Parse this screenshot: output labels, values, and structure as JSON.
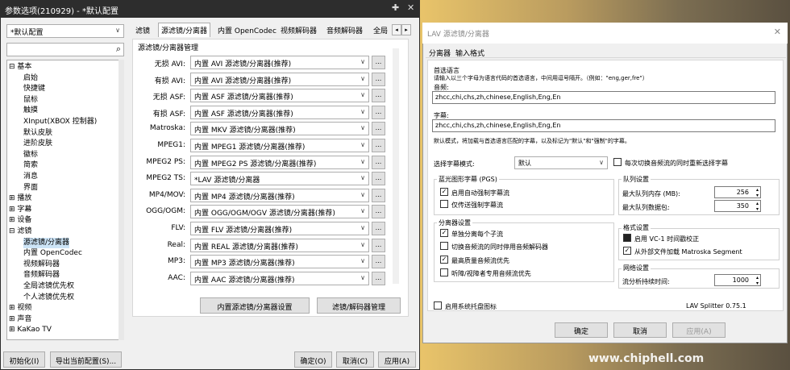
{
  "left": {
    "title": "参数选项(210929) - *默认配置",
    "profile": "*默认配置",
    "tree": [
      {
        "t": "基本",
        "lvl": 0,
        "exp": "⊟"
      },
      {
        "t": "启始",
        "lvl": 1
      },
      {
        "t": "快捷键",
        "lvl": 1
      },
      {
        "t": "鼠标",
        "lvl": 1
      },
      {
        "t": "触摸",
        "lvl": 1
      },
      {
        "t": "XInput(XBOX 控制器)",
        "lvl": 1
      },
      {
        "t": "默认皮肤",
        "lvl": 1
      },
      {
        "t": "进阶皮肤",
        "lvl": 1
      },
      {
        "t": "徽标",
        "lvl": 1
      },
      {
        "t": "简索",
        "lvl": 1
      },
      {
        "t": "消息",
        "lvl": 1
      },
      {
        "t": "界面",
        "lvl": 1
      },
      {
        "t": "播放",
        "lvl": 0,
        "exp": "⊞"
      },
      {
        "t": "字幕",
        "lvl": 0,
        "exp": "⊞"
      },
      {
        "t": "设备",
        "lvl": 0,
        "exp": "⊞"
      },
      {
        "t": "滤镜",
        "lvl": 0,
        "exp": "⊟"
      },
      {
        "t": "源滤镜/分离器",
        "lvl": 1,
        "sel": true
      },
      {
        "t": "内置 OpenCodec",
        "lvl": 1
      },
      {
        "t": "视频解码器",
        "lvl": 1
      },
      {
        "t": "音频解码器",
        "lvl": 1
      },
      {
        "t": "全局滤镜优先权",
        "lvl": 1
      },
      {
        "t": "个人滤镜优先权",
        "lvl": 1
      },
      {
        "t": "视频",
        "lvl": 0,
        "exp": "⊞"
      },
      {
        "t": "声音",
        "lvl": 0,
        "exp": "⊞"
      },
      {
        "t": "KaKao TV",
        "lvl": 0,
        "exp": "⊞"
      }
    ],
    "tabs": [
      "滤镜",
      "源滤镜/分离器",
      "内置 OpenCodec",
      "视频解码器",
      "音频解码器",
      "全局"
    ],
    "group_title": "源滤镜/分离器管理",
    "rows": [
      {
        "l": "无损 AVI:",
        "v": "内置 AVI 源滤镜/分离器(推荐)"
      },
      {
        "l": "有损 AVI:",
        "v": "内置 AVI 源滤镜/分离器(推荐)"
      },
      {
        "l": "无损 ASF:",
        "v": "内置 ASF 源滤镜/分离器(推荐)"
      },
      {
        "l": "有损 ASF:",
        "v": "内置 ASF 源滤镜/分离器(推荐)"
      },
      {
        "l": "Matroska:",
        "v": "内置 MKV 源滤镜/分离器(推荐)"
      },
      {
        "l": "MPEG1:",
        "v": "内置 MPEG1 源滤镜/分离器(推荐)"
      },
      {
        "l": "MPEG2 PS:",
        "v": "内置 MPEG2 PS 源滤镜/分离器(推荐)"
      },
      {
        "l": "MPEG2 TS:",
        "v": "*LAV 源滤镜/分离器"
      },
      {
        "l": "MP4/MOV:",
        "v": "内置 MP4 源滤镜/分离器(推荐)"
      },
      {
        "l": "OGG/OGM:",
        "v": "内置 OGG/OGM/OGV 源滤镜/分离器(推荐)"
      },
      {
        "l": "FLV:",
        "v": "内置 FLV 源滤镜/分离器(推荐)"
      },
      {
        "l": "Real:",
        "v": "内置 REAL 源滤镜/分离器(推荐)"
      },
      {
        "l": "MP3:",
        "v": "内置 MP3 源滤镜/分离器(推荐)"
      },
      {
        "l": "AAC:",
        "v": "内置 AAC 源滤镜/分离器(推荐)"
      }
    ],
    "btn_builtin": "内置源滤镜/分离器设置",
    "btn_mgr": "滤镜/解码器管理",
    "btn_init": "初始化(I)",
    "btn_export": "导出当前配置(S)...",
    "btn_ok": "确定(O)",
    "btn_cancel": "取消(C)",
    "btn_apply": "应用(A)"
  },
  "right": {
    "title": "LAV 源滤镜/分离器",
    "tab1": "分离器",
    "tab2": "输入格式",
    "pref_lang": "首选语言",
    "pref_desc": "请输入以三个字母为语言代码的首选语言，中间用逗号隔开。（例如：\"eng,ger,fre\"）",
    "audio_lbl": "音频:",
    "audio_val": "zhcc,chi,chs,zh,chinese,English,Eng,En",
    "sub_lbl": "字幕:",
    "sub_val": "zhcc,chi,chs,zh,chinese,English,Eng,En",
    "default_desc": "默认模式，将加载与首选语言匹配的字幕，以及标记为\"默认\"和\"强制\"的字幕。",
    "sub_mode_lbl": "选择字幕模式:",
    "sub_mode_val": "默认",
    "reselect": "每次切换音频流的同时重新选择字幕",
    "pgs_title": "蓝光图形字幕 (PGS)",
    "pgs1": "启用自动强制字幕流",
    "pgs2": "仅传送强制字幕流",
    "queue_title": "队列设置",
    "q_mem": "最大队列内存 (MB):",
    "q_mem_val": "256",
    "q_pk": "最大队列数据包:",
    "q_pk_val": "350",
    "split_title": "分离器设置",
    "s1": "单独分离每个子流",
    "s2": "切换音频流的同时停用音频解码器",
    "s3": "最高质量音频流优先",
    "s4": "听障/视障者专用音频流优先",
    "fmt_title": "格式设置",
    "f1": "启用 VC-1 时间戳校正",
    "f2": "从外部文件加载 Matroska Segment",
    "net_title": "网络设置",
    "net_lbl": "流分析持续时间:",
    "net_val": "1000",
    "tray": "启用系统托盘图标",
    "version": "LAV Splitter 0.75.1",
    "ok": "确定",
    "cancel": "取消",
    "apply": "应用(A)"
  },
  "watermark": "www.chiphell.com"
}
